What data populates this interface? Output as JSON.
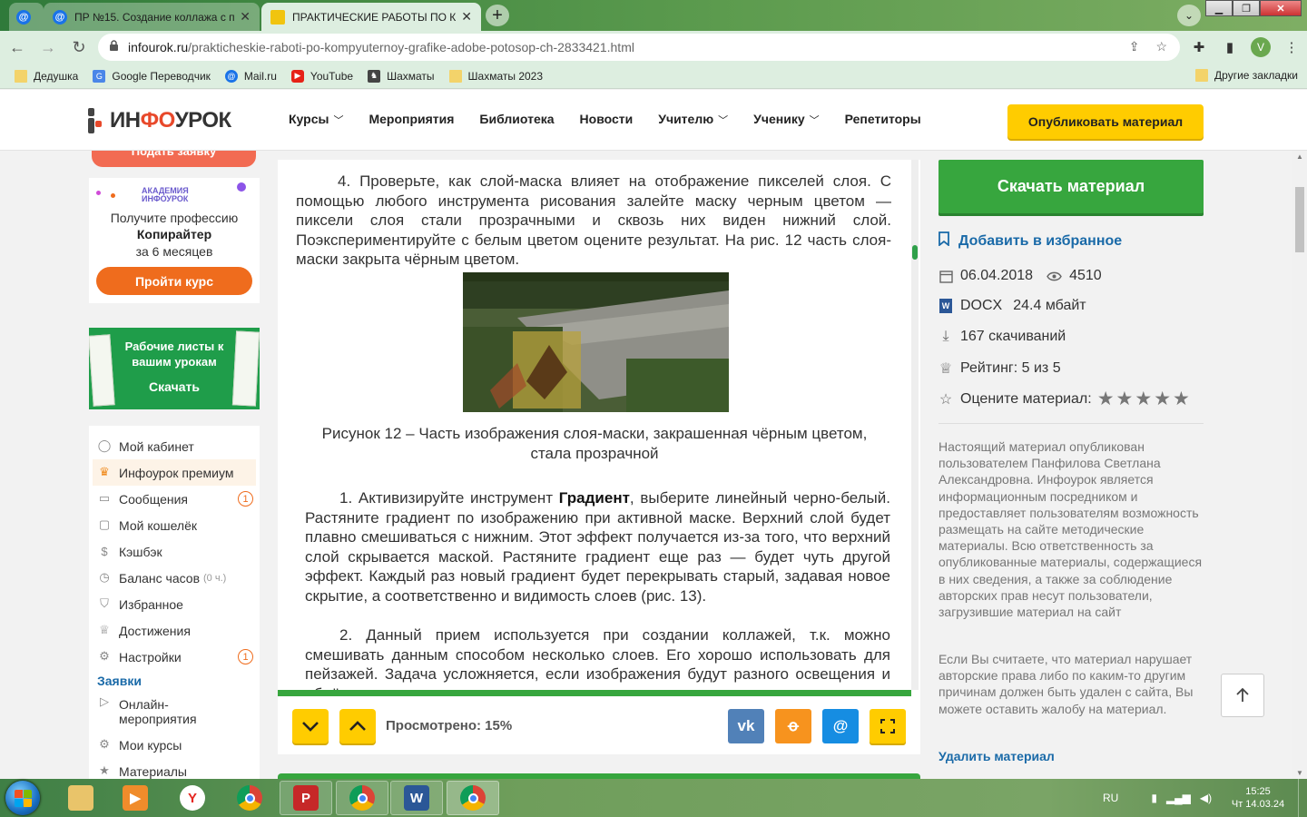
{
  "browser": {
    "tabs": [
      {
        "title": ""
      },
      {
        "title": "ПР №15. Создание коллажа с п"
      },
      {
        "title": "ПРАКТИЧЕСКИЕ РАБОТЫ ПО КО"
      }
    ],
    "url_host": "infourok.ru",
    "url_path": "/prakticheskie-raboti-po-kompyuternoy-grafike-adobe-potosop-ch-2833421.html",
    "profile_initial": "V",
    "bookmarks": [
      {
        "label": "Дедушка",
        "icon": "folder-icon"
      },
      {
        "label": "Google Переводчик",
        "icon": "translate-icon"
      },
      {
        "label": "Mail.ru",
        "icon": "mail-icon"
      },
      {
        "label": "YouTube",
        "icon": "youtube-icon"
      },
      {
        "label": "Шахматы",
        "icon": "chess-icon"
      },
      {
        "label": "Шахматы 2023",
        "icon": "folder-icon"
      }
    ],
    "other_bookmarks": "Другие закладки"
  },
  "site": {
    "logo_left": "ИН",
    "logo_mid": "ФО",
    "logo_right": "УРОК",
    "nav": [
      {
        "label": "Курсы",
        "dropdown": true
      },
      {
        "label": "Мероприятия",
        "dropdown": false
      },
      {
        "label": "Библиотека",
        "dropdown": false
      },
      {
        "label": "Новости",
        "dropdown": false
      },
      {
        "label": "Учителю",
        "dropdown": true
      },
      {
        "label": "Ученику",
        "dropdown": true
      },
      {
        "label": "Репетиторы",
        "dropdown": false
      }
    ],
    "publish_label": "Опубликовать материал"
  },
  "left": {
    "red_button_label": "Подать заявку",
    "promo": {
      "brand_1": "АКАДЕМИЯ",
      "brand_2": "ИНФОУРОК",
      "line1": "Получите профессию",
      "line2": "Копирайтер",
      "line3": "за 6 месяцев",
      "button": "Пройти курс"
    },
    "worksheets": {
      "title": "Рабочие листы к вашим урокам",
      "button": "Скачать"
    },
    "menu": [
      {
        "label": "Мой кабинет",
        "icon": "user-icon"
      },
      {
        "label": "Инфоурок премиум",
        "icon": "crown-icon",
        "active": true
      },
      {
        "label": "Сообщения",
        "icon": "message-icon",
        "badge": "1"
      },
      {
        "label": "Мой кошелёк",
        "icon": "wallet-icon"
      },
      {
        "label": "Кэшбэк",
        "icon": "cashback-icon"
      },
      {
        "label": "Баланс часов",
        "icon": "clock-icon",
        "extra": "(0 ч.)"
      },
      {
        "label": "Избранное",
        "icon": "bookmark-icon"
      },
      {
        "label": "Достижения",
        "icon": "trophy-icon"
      },
      {
        "label": "Настройки",
        "icon": "gear-icon",
        "badge": "1"
      }
    ],
    "section_title": "Заявки",
    "menu2": [
      {
        "label": "Онлайн-мероприятия",
        "icon": "play-icon"
      },
      {
        "label": "Мои курсы",
        "icon": "gear-icon"
      },
      {
        "label": "Материалы",
        "icon": "star-icon"
      }
    ]
  },
  "document": {
    "p1": "4. Проверьте, как слой-маска влияет на отображение пикселей слоя. С помощью любого инструмента рисования залейте маску черным цветом — пиксели слоя стали прозрачными и сквозь них виден нижний слой. Поэкспериментируйте с белым цветом оцените результат. На рис. 12 часть слоя-маски закрыта чёрным цветом.",
    "caption_1": "Рисунок 12 – Часть изображения слоя-маски, закрашенная чёрным цветом,",
    "caption_2": "стала прозрачной",
    "p2_a": "1.  Активизируйте инструмент ",
    "p2_b": "Градиент",
    "p2_c": ", выберите линейный черно-белый. Растяните градиент по изображению при активной маске. Верхний слой будет плавно смешиваться с нижним. Этот эффект получается из-за того, что верхний слой скрывается маской. Растяните градиент еще раз — будет чуть другой эффект. Каждый раз новый градиент будет перекрывать старый, задавая новое скрытие, а соответственно и видимость слоев (рис. 13).",
    "p3": "2.  Данный прием используется при создании коллажей, т.к. можно смешивать данным способом несколько слоев. Его хорошо использовать для пейзажей. Задача усложняется, если изображения будут разного освещения и объёма.",
    "viewed": "Просмотрено: 15%",
    "viewed_percent": 15
  },
  "right": {
    "download": "Скачать материал",
    "favorite": "Добавить в избранное",
    "date": "06.04.2018",
    "views": "4510",
    "file_type": "DOCX",
    "file_size": "24.4 мбайт",
    "downloads": "167 скачиваний",
    "rating": "Рейтинг: 5 из 5",
    "rate_label": "Оцените материал:",
    "rate_stars": 5,
    "disclaimer": "Настоящий материал опубликован пользователем Панфилова Светлана Александровна. Инфоурок является информационным посредником и предоставляет пользователям возможность размещать на сайте методические материалы. Всю ответственность за опубликованные материалы, содержащиеся в них сведения, а также за соблюдение авторских прав несут пользователи, загрузившие материал на сайт",
    "complaint": "Если Вы считаете, что материал нарушает авторские права либо по каким-то другим причинам должен быть удален с сайта, Вы можете оставить жалобу на материал.",
    "delete": "Удалить материал"
  },
  "taskbar": {
    "lang": "RU",
    "time": "15:25",
    "date": "Чт 14.03.24"
  },
  "colors": {
    "green": "#37a63e",
    "yellow": "#ffcc00",
    "orange": "#ef6c1d",
    "link_blue": "#1a6aa8",
    "vk": "#5181b8",
    "ok": "#f7931e",
    "mail": "#168de2"
  }
}
